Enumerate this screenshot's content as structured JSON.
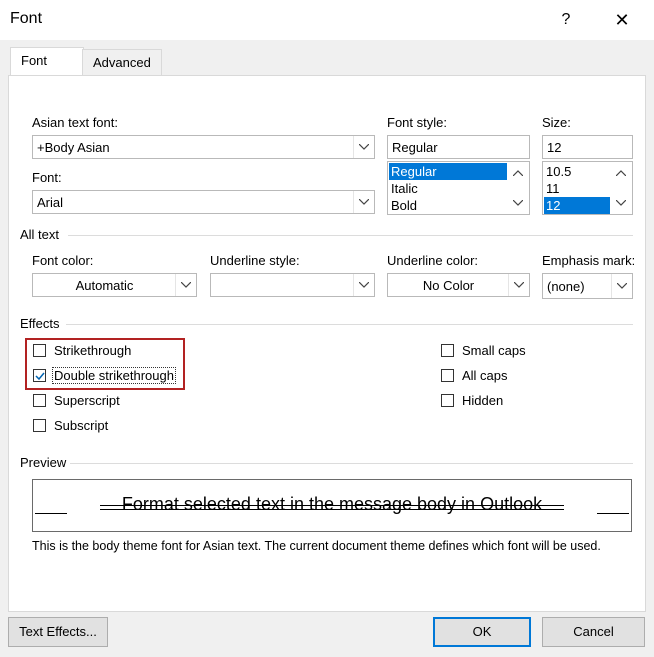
{
  "window": {
    "title": "Font",
    "help": "?",
    "close": "✕"
  },
  "tabs": [
    {
      "label": "Font"
    },
    {
      "label": "Advanced"
    }
  ],
  "font_section": {
    "asian_font": {
      "label": "Asian text font:",
      "value": "+Body Asian"
    },
    "font": {
      "label": "Font:",
      "value": "Arial"
    },
    "style": {
      "label": "Font style:",
      "value": "Regular",
      "options": [
        "Regular",
        "Italic",
        "Bold"
      ],
      "selected": "Regular"
    },
    "size": {
      "label": "Size:",
      "value": "12",
      "options": [
        "10.5",
        "11",
        "12"
      ],
      "selected": "12"
    }
  },
  "all_text": {
    "title": "All text",
    "font_color": {
      "label": "Font color:",
      "value": "Automatic"
    },
    "underline_style": {
      "label": "Underline style:",
      "value": ""
    },
    "underline_color": {
      "label": "Underline color:",
      "value": "No Color"
    },
    "emphasis_mark": {
      "label": "Emphasis mark:",
      "value": "(none)"
    }
  },
  "effects": {
    "title": "Effects",
    "items": [
      {
        "label": "Strikethrough",
        "checked": false
      },
      {
        "label": "Double strikethrough",
        "checked": true
      },
      {
        "label": "Superscript",
        "checked": false
      },
      {
        "label": "Subscript",
        "checked": false
      },
      {
        "label": "Small caps",
        "checked": false
      },
      {
        "label": "All caps",
        "checked": false
      },
      {
        "label": "Hidden",
        "checked": false
      }
    ],
    "highlight_color": "#b22222"
  },
  "preview": {
    "title": "Preview",
    "sample": "Format selected text in the message body in Outlook",
    "note": "This is the body theme font for Asian text. The current document theme defines which font will be used."
  },
  "buttons": {
    "text_effects": "Text Effects...",
    "ok": "OK",
    "cancel": "Cancel"
  },
  "colors": {
    "selection": "#0078d7",
    "primary_border": "#0078d7"
  }
}
